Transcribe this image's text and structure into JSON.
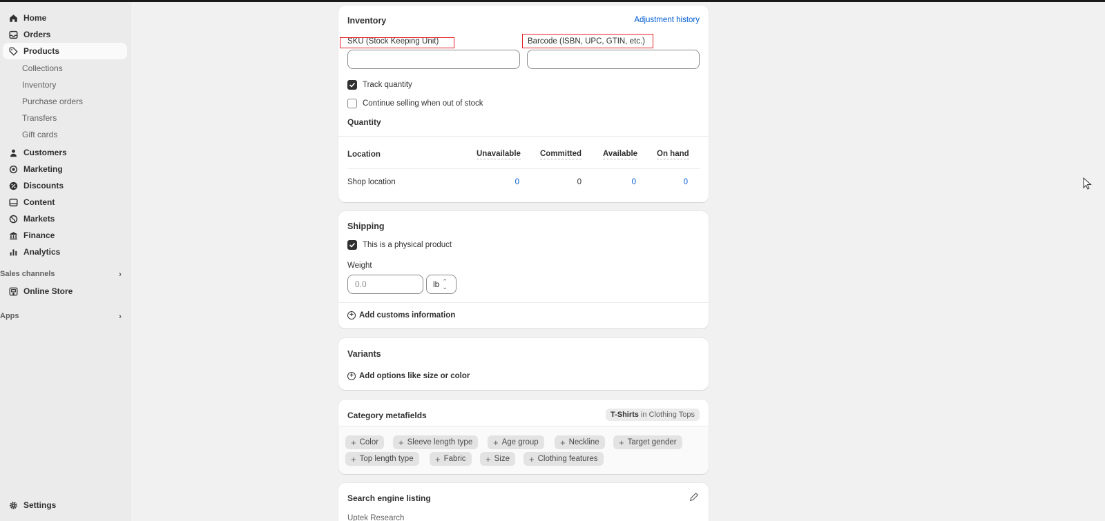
{
  "sidebar": {
    "nav": [
      {
        "label": "Home",
        "icon": "home-icon"
      },
      {
        "label": "Orders",
        "icon": "inbox-icon"
      },
      {
        "label": "Products",
        "icon": "tag-icon",
        "active": true
      }
    ],
    "products_sub": [
      "Collections",
      "Inventory",
      "Purchase orders",
      "Transfers",
      "Gift cards"
    ],
    "nav2": [
      {
        "label": "Customers",
        "icon": "person-icon"
      },
      {
        "label": "Marketing",
        "icon": "target-icon"
      },
      {
        "label": "Discounts",
        "icon": "discount-icon"
      },
      {
        "label": "Content",
        "icon": "image-icon"
      },
      {
        "label": "Markets",
        "icon": "globe-icon"
      },
      {
        "label": "Finance",
        "icon": "bank-icon"
      },
      {
        "label": "Analytics",
        "icon": "bar-chart-icon"
      }
    ],
    "sales_channels": "Sales channels",
    "online_store": "Online Store",
    "apps": "Apps",
    "settings": "Settings"
  },
  "inventory": {
    "title": "Inventory",
    "adjustment_link": "Adjustment history",
    "sku_label": "SKU (Stock Keeping Unit)",
    "sku_value": "",
    "barcode_label": "Barcode (ISBN, UPC, GTIN, etc.)",
    "barcode_value": "",
    "track_quantity": {
      "label": "Track quantity",
      "checked": true
    },
    "continue_selling": {
      "label": "Continue selling when out of stock",
      "checked": false
    },
    "quantity_title": "Quantity",
    "columns": [
      "Location",
      "Unavailable",
      "Committed",
      "Available",
      "On hand"
    ],
    "rows": [
      {
        "location": "Shop location",
        "unavailable": "0",
        "committed": "0",
        "available": "0",
        "on_hand": "0"
      }
    ]
  },
  "shipping": {
    "title": "Shipping",
    "physical": {
      "label": "This is a physical product",
      "checked": true
    },
    "weight_label": "Weight",
    "weight_placeholder": "0.0",
    "unit": "lb",
    "customs": "Add customs information"
  },
  "variants": {
    "title": "Variants",
    "add_options": "Add options like size or color"
  },
  "category_metafields": {
    "title": "Category metafields",
    "badge_bold": "T-Shirts",
    "badge_rest": "in Clothing Tops",
    "chips": [
      "Color",
      "Sleeve length type",
      "Age group",
      "Neckline",
      "Target gender",
      "Top length type",
      "Fabric",
      "Size",
      "Clothing features"
    ]
  },
  "seo": {
    "title": "Search engine listing",
    "store_name": "Uptek Research"
  },
  "colors": {
    "accent": "#005bd3",
    "highlight": "#e51c23"
  }
}
